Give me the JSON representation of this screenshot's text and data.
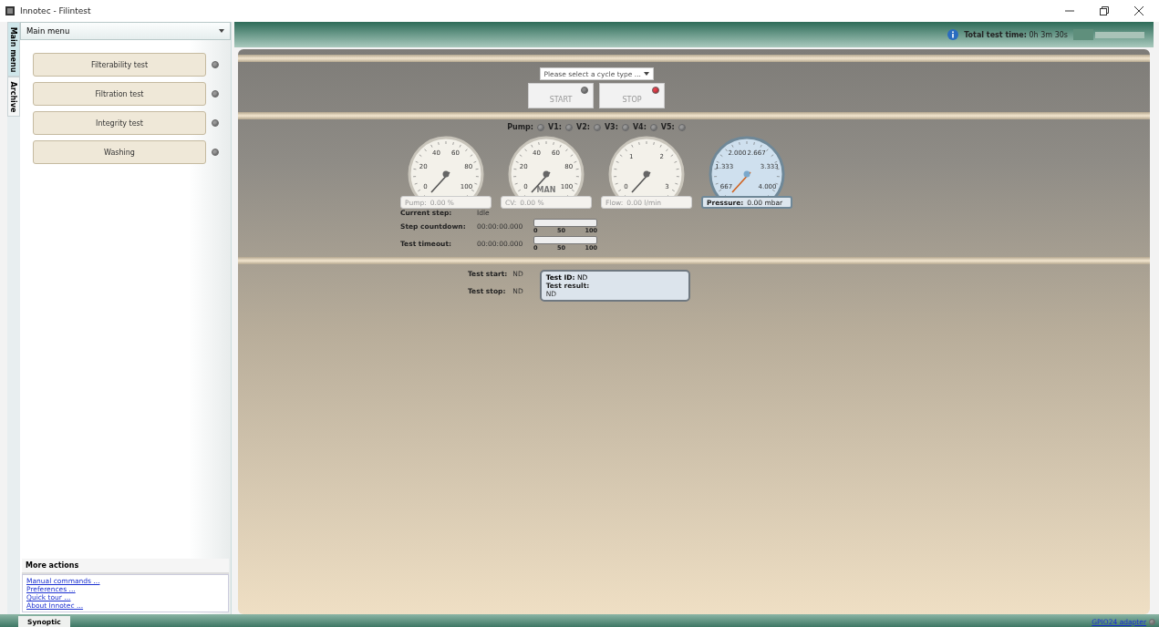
{
  "window": {
    "title": "Innotec - Filintest"
  },
  "side_tabs": [
    {
      "label": "Main menu",
      "selected": true
    },
    {
      "label": "Archive",
      "selected": false
    }
  ],
  "menu": {
    "title": "Main menu",
    "items": [
      {
        "label": "Filterability test",
        "on": false
      },
      {
        "label": "Filtration test",
        "on": false
      },
      {
        "label": "Integrity test",
        "on": false
      },
      {
        "label": "Washing",
        "on": false
      }
    ]
  },
  "more_actions": {
    "title": "More actions",
    "links": [
      "Manual commands ...",
      "Preferences ...",
      "Quick tour ...",
      "About Innotec ..."
    ]
  },
  "header": {
    "total_label": "Total test time:",
    "total_value": "0h 3m 30s"
  },
  "cycle_select": {
    "placeholder": "Please select a cycle type ..."
  },
  "controls": [
    {
      "label": "START",
      "color": "#8a8a8a"
    },
    {
      "label": "STOP",
      "color": "#e8404c"
    }
  ],
  "outputs": [
    {
      "label": "Pump:",
      "on": false
    },
    {
      "label": "V1:",
      "on": false
    },
    {
      "label": "V2:",
      "on": false
    },
    {
      "label": "V3:",
      "on": false
    },
    {
      "label": "V4:",
      "on": false
    },
    {
      "label": "V5:",
      "on": false
    }
  ],
  "gauges": [
    {
      "ticks": [
        "0",
        "20",
        "40",
        "60",
        "80",
        "100"
      ],
      "label": "Pump:",
      "reading": "0.00 %",
      "highlighted": false
    },
    {
      "ticks": [
        "0",
        "20",
        "40",
        "60",
        "80",
        "100"
      ],
      "caption": "MAN",
      "label": "CV:",
      "reading": "0.00 %",
      "highlighted": false
    },
    {
      "ticks": [
        "0",
        "1",
        "2",
        "3"
      ],
      "label": "Flow:",
      "reading": "0.00 l/min",
      "highlighted": false
    },
    {
      "ticks": [
        "667",
        "1.333",
        "2.000",
        "2.667",
        "3.333",
        "4.000"
      ],
      "label": "Pressure:",
      "reading": "0.00 mbar",
      "highlighted": true
    }
  ],
  "status": [
    {
      "kind": "text",
      "label": "Current step:",
      "value": "Idle"
    },
    {
      "kind": "timer",
      "label": "Step countdown:",
      "value": "00:00:00.000",
      "level": 0,
      "scale": [
        "0",
        "50",
        "100"
      ]
    },
    {
      "kind": "timer",
      "label": "Test timeout:",
      "value": "00:00:00.000",
      "level": 0,
      "scale": [
        "0",
        "50",
        "100"
      ]
    }
  ],
  "results": {
    "start_label": "Test start:",
    "start_value": "ND",
    "stop_label": "Test stop:",
    "stop_value": "ND",
    "id_label": "Test ID:",
    "id_value": "ND",
    "result_label": "Test result:",
    "result_value": "ND"
  },
  "status_bar": {
    "tabs": [
      {
        "label": "Synoptic",
        "selected": true
      }
    ],
    "adapter": {
      "label": "GPIO24 adapter",
      "on": false
    }
  }
}
